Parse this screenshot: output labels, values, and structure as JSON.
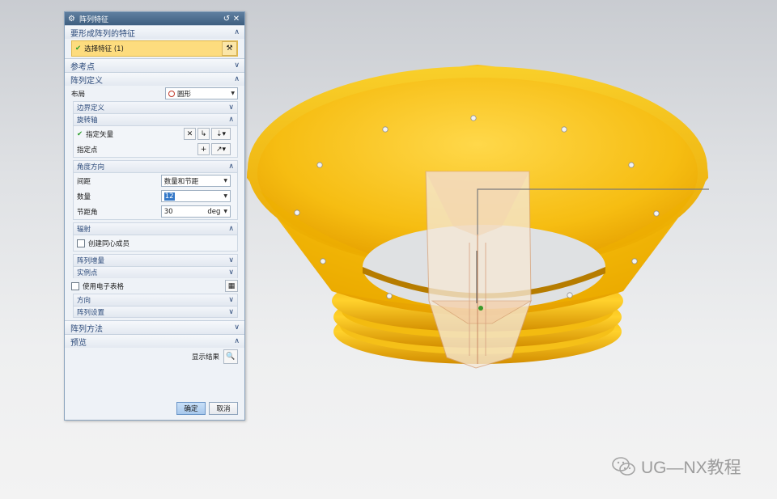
{
  "dialog": {
    "title": "阵列特征",
    "sections": {
      "features_header": "要形成阵列的特征",
      "select_feature": "选择特征 (1)",
      "reference_point": "参考点",
      "pattern_definition": "阵列定义",
      "layout_label": "布局",
      "layout_value": "圆形",
      "boundary_definition": "边界定义",
      "rotation_axis": "旋转轴",
      "specify_vector": "指定矢量",
      "specify_point": "指定点",
      "angle_direction": "角度方向",
      "spacing_label": "间距",
      "spacing_value": "数量和节距",
      "count_label": "数量",
      "count_value": "12",
      "pitch_label": "节距角",
      "pitch_value": "30",
      "pitch_unit": "deg",
      "radiate": "辐射",
      "create_concentric": "创建同心成员",
      "pattern_increment": "阵列增量",
      "instance_point": "实例点",
      "use_spreadsheet": "使用电子表格",
      "orientation": "方向",
      "pattern_settings": "阵列设置",
      "pattern_method": "阵列方法",
      "preview": "预览",
      "show_result": "显示结果"
    },
    "buttons": {
      "ok": "确定",
      "cancel": "取消"
    }
  },
  "watermark": {
    "text": "UG—NX教程"
  },
  "colors": {
    "part_yellow": "#f7c11a",
    "part_dark": "#d99700",
    "selection_highlight": "#fddc7e",
    "title_bar": "#4f6f90"
  }
}
